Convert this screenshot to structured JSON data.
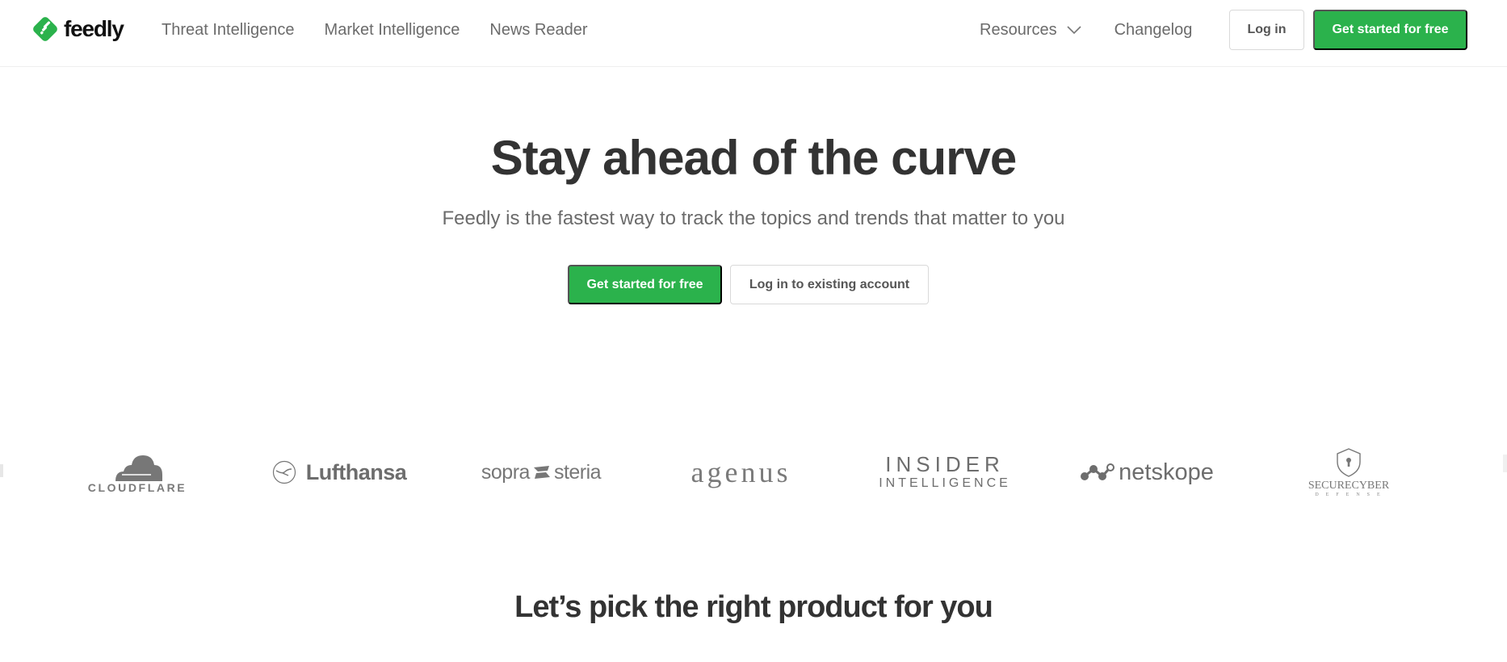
{
  "colors": {
    "brand_green": "#2bb24c",
    "text_dark": "#333333",
    "text_muted": "#6b6b6b",
    "logo_gray": "#6d6d6d"
  },
  "header": {
    "logo_text": "feedly",
    "logo_icon": "feedly-logo-icon",
    "nav_left": [
      {
        "label": "Threat Intelligence"
      },
      {
        "label": "Market Intelligence"
      },
      {
        "label": "News Reader"
      }
    ],
    "resources_label": "Resources",
    "resources_icon": "chevron-down-icon",
    "changelog_label": "Changelog",
    "login_label": "Log in",
    "get_started_label": "Get started for free"
  },
  "hero": {
    "title": "Stay ahead of the curve",
    "subtitle": "Feedly is the fastest way to track the topics and trends that matter to you",
    "primary_cta": "Get started for free",
    "secondary_cta": "Log in to existing account"
  },
  "customer_logos": [
    {
      "name": "Cloudflare",
      "text": "CLOUDFLARE"
    },
    {
      "name": "Lufthansa",
      "text": "Lufthansa"
    },
    {
      "name": "Sopra Steria",
      "text_left": "sopra",
      "text_right": "steria"
    },
    {
      "name": "Agenus",
      "text": "agenus"
    },
    {
      "name": "Insider Intelligence",
      "line1": "INSIDER",
      "line2": "INTELLIGENCE"
    },
    {
      "name": "Netskope",
      "text": "netskope"
    },
    {
      "name": "SecureCyber Defense",
      "line1": "SECURECYBER",
      "line2": "DEFENSE"
    }
  ],
  "products_section": {
    "title": "Let’s pick the right product for you"
  }
}
